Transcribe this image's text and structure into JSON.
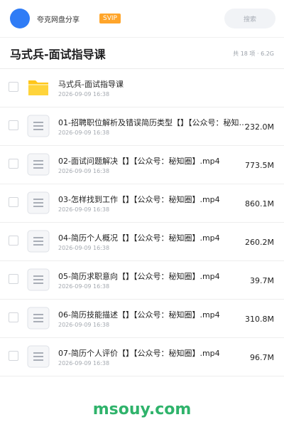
{
  "header": {
    "app_name": "夸克网盘分享",
    "vip_label": "SVIP",
    "search_placeholder": "搜索"
  },
  "folder": {
    "title": "马式兵-面试指导课",
    "summary": "共 18 项 · 6.2G"
  },
  "files": [
    {
      "name": "马式兵-面试指导课",
      "date": "2026-09-09 16:38",
      "size": "",
      "icon": "folder-icon"
    },
    {
      "name": "01-招聘职位解析及错误简历类型【】【公众号：秘知…",
      "date": "2026-09-09 16:38",
      "size": "232.0M",
      "icon": "document-icon"
    },
    {
      "name": "02-面试问题解决【】【公众号：秘知圈】.mp4",
      "date": "2026-09-09 16:38",
      "size": "773.5M",
      "icon": "document-icon"
    },
    {
      "name": "03-怎样找到工作【】【公众号：秘知圈】.mp4",
      "date": "2026-09-09 16:38",
      "size": "860.1M",
      "icon": "document-icon"
    },
    {
      "name": "04-简历个人概况【】【公众号：秘知圈】.mp4",
      "date": "2026-09-09 16:38",
      "size": "260.2M",
      "icon": "document-icon"
    },
    {
      "name": "05-简历求职意向【】【公众号：秘知圈】.mp4",
      "date": "2026-09-09 16:38",
      "size": "39.7M",
      "icon": "document-icon"
    },
    {
      "name": "06-简历技能描述【】【公众号：秘知圈】.mp4",
      "date": "2026-09-09 16:38",
      "size": "310.8M",
      "icon": "document-icon"
    },
    {
      "name": "07-简历个人评价【】【公众号：秘知圈】.mp4",
      "date": "2026-09-09 16:38",
      "size": "96.7M",
      "icon": "document-icon"
    }
  ],
  "watermark": "msouy.com",
  "colors": {
    "accent_blue": "#2f7cf6",
    "vip_orange": "#ffa52a",
    "folder_yellow": "#ffc61a",
    "watermark_green": "#2fb36b"
  }
}
